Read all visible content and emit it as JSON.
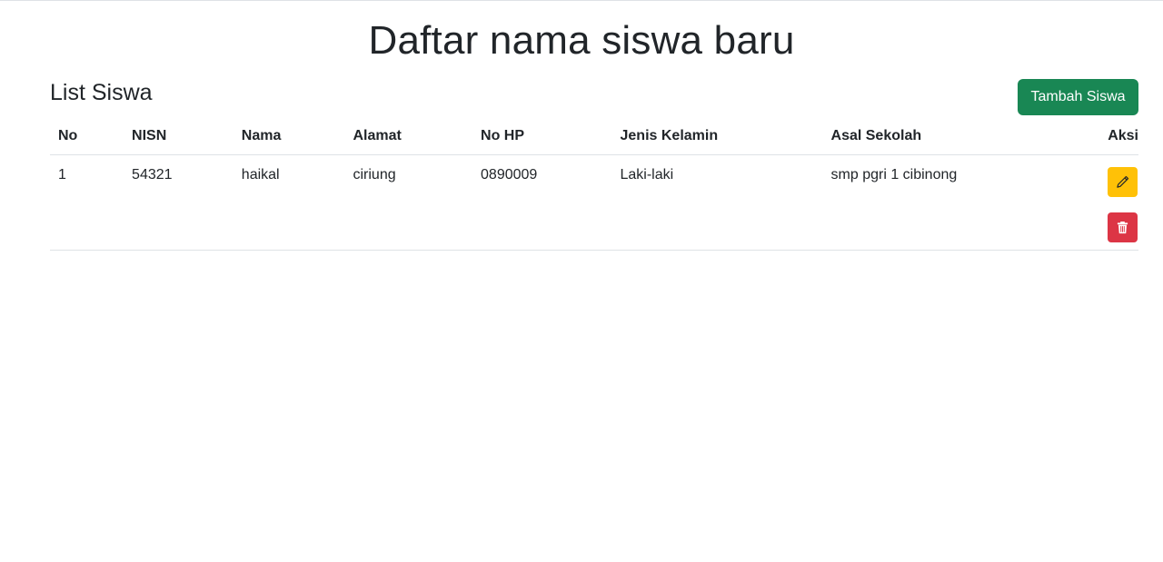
{
  "page": {
    "title": "Daftar nama siswa baru",
    "list_heading": "List Siswa",
    "add_button_label": "Tambah Siswa"
  },
  "table": {
    "headers": [
      "No",
      "NISN",
      "Nama",
      "Alamat",
      "No HP",
      "Jenis Kelamin",
      "Asal Sekolah",
      "Aksi"
    ],
    "rows": [
      {
        "no": "1",
        "nisn": "54321",
        "nama": "haikal",
        "alamat": "ciriung",
        "no_hp": "0890009",
        "jenis_kelamin": "Laki-laki",
        "asal_sekolah": "smp pgri 1 cibinong",
        "actions": [
          {
            "icon": "pencil-icon",
            "color": "#ffc107"
          },
          {
            "icon": "trash-icon",
            "color": "#dc3545"
          }
        ]
      }
    ]
  },
  "colors": {
    "primary_text": "#212529",
    "add_button": "#198754",
    "edit_button": "#ffc107",
    "delete_button": "#dc3545",
    "divider": "#dee2e6"
  }
}
